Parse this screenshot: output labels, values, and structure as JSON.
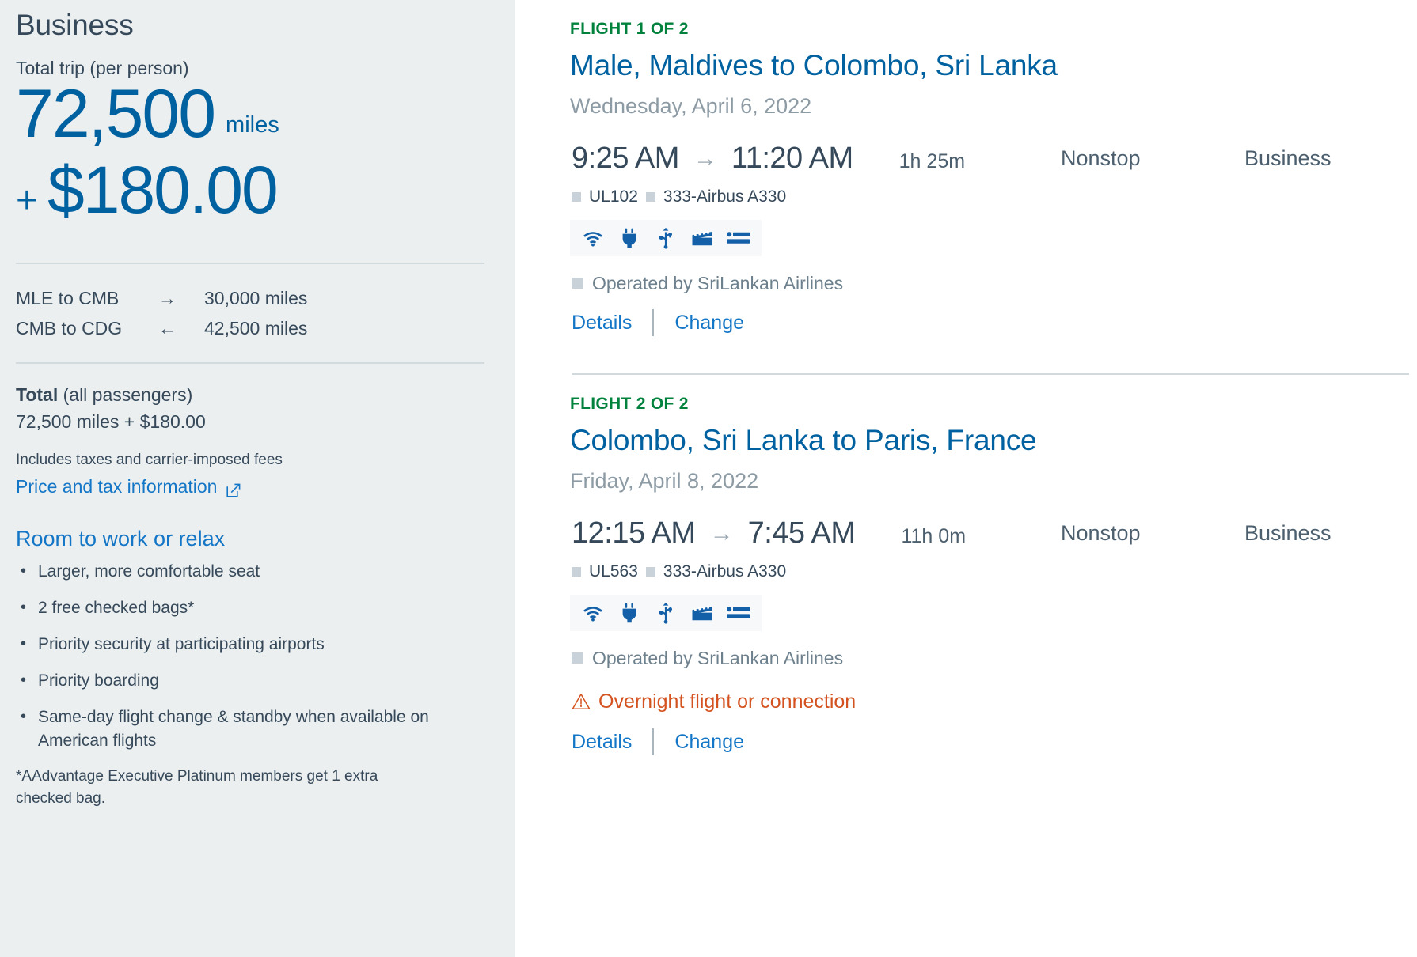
{
  "sidebar": {
    "cabin_title": "Business",
    "total_trip_label": "Total trip (per person)",
    "miles_amount": "72,500",
    "miles_word": "miles",
    "cash_plus": "+",
    "cash_amount": "$180.00",
    "segments": [
      {
        "route": "MLE to CMB",
        "arrow": "→",
        "miles": "30,000 miles"
      },
      {
        "route": "CMB to CDG",
        "arrow": "←",
        "miles": "42,500 miles"
      }
    ],
    "total_label_bold": "Total",
    "total_label_rest": " (all passengers)",
    "total_value": "72,500 miles + $180.00",
    "taxes_note": "Includes taxes and carrier-imposed fees",
    "price_tax_link": "Price and tax information",
    "price_tax_icon": "external-link-icon",
    "benefits_title": "Room to work or relax",
    "benefits": [
      "Larger, more comfortable seat",
      "2 free checked bags*",
      "Priority security at participating airports",
      "Priority boarding",
      "Same-day flight change & standby when available on American flights"
    ],
    "footnote": "*AAdvantage Executive Platinum members get 1 extra checked bag."
  },
  "flights": [
    {
      "eyebrow": "FLIGHT 1 OF 2",
      "route": "Male, Maldives to Colombo, Sri Lanka",
      "date": "Wednesday, April 6, 2022",
      "depart_time": "9:25 AM",
      "arrow": "→",
      "arrive_time": "11:20 AM",
      "duration": "1h 25m",
      "stops": "Nonstop",
      "cabin": "Business",
      "flight_number": "UL102",
      "aircraft": "333-Airbus A330",
      "amenities": [
        "wifi-icon",
        "power-outlet-icon",
        "usb-port-icon",
        "entertainment-icon",
        "lie-flat-seat-icon"
      ],
      "operated_by": "Operated by SriLankan Airlines",
      "warning": "",
      "details_label": "Details",
      "change_label": "Change"
    },
    {
      "eyebrow": "FLIGHT 2 OF 2",
      "route": "Colombo, Sri Lanka to Paris, France",
      "date": "Friday, April 8, 2022",
      "depart_time": "12:15 AM",
      "arrow": "→",
      "arrive_time": "7:45 AM",
      "duration": "11h 0m",
      "stops": "Nonstop",
      "cabin": "Business",
      "flight_number": "UL563",
      "aircraft": "333-Airbus A330",
      "amenities": [
        "wifi-icon",
        "power-outlet-icon",
        "usb-port-icon",
        "entertainment-icon",
        "lie-flat-seat-icon"
      ],
      "operated_by": "Operated by SriLankan Airlines",
      "warning": "Overnight flight or connection",
      "details_label": "Details",
      "change_label": "Change"
    }
  ],
  "colors": {
    "sidebar_bg": "#eceff0",
    "brand_blue": "#0061a0",
    "link_blue": "#1476c6",
    "eyebrow_green": "#00823d",
    "warning_orange": "#d4521f",
    "text_slate": "#36495a",
    "muted_gray": "#8d9ba5",
    "icon_blue": "#1360a8"
  }
}
